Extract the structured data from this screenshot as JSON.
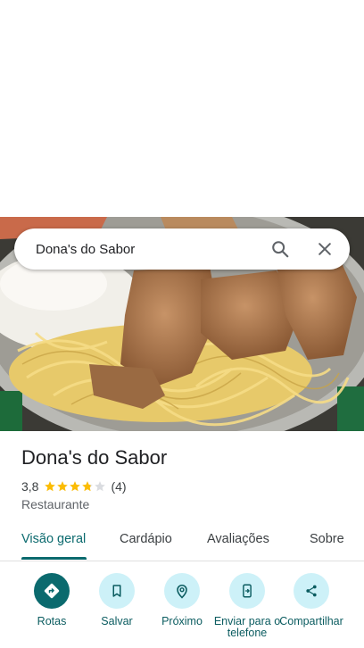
{
  "search": {
    "query": "Dona's do Sabor"
  },
  "place": {
    "name": "Dona's do Sabor",
    "rating": "3,8",
    "rating_value": 3.8,
    "rating_max": 5,
    "review_count": "(4)",
    "category": "Restaurante"
  },
  "tabs": [
    {
      "label": "Visão geral",
      "active": true
    },
    {
      "label": "Cardápio"
    },
    {
      "label": "Avaliações"
    },
    {
      "label": "Sobre"
    }
  ],
  "actions": [
    {
      "label": "Rotas",
      "icon": "directions-icon"
    },
    {
      "label": "Salvar",
      "icon": "bookmark-icon"
    },
    {
      "label": "Próximo",
      "icon": "nearby-icon"
    },
    {
      "label": "Enviar para o telefone",
      "icon": "send-to-phone-icon"
    },
    {
      "label": "Compartilhar",
      "icon": "share-icon"
    }
  ],
  "colors": {
    "accent": "#0b6a6e",
    "action_bg": "#cdf1f8",
    "star": "#fbbc04",
    "star_empty": "#dadce0"
  }
}
